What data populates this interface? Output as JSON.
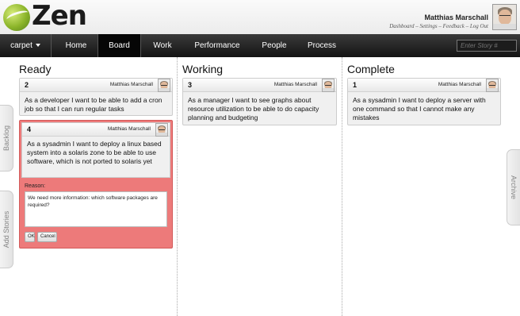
{
  "app": {
    "logo_text": "Zen"
  },
  "user": {
    "name": "Matthias Marschall",
    "links": [
      "Dashboard",
      "Settings",
      "Feedback",
      "Log Out"
    ],
    "link_separator": " – "
  },
  "nav": {
    "project": "carpet",
    "items": [
      "Home",
      "Board",
      "Work",
      "Performance",
      "People",
      "Process"
    ],
    "active": "Board",
    "search_placeholder": "Enter Story #"
  },
  "side_tabs": {
    "backlog": "Backlog",
    "add_stories": "Add Stories",
    "archive": "Archive"
  },
  "columns": [
    {
      "title": "Ready",
      "cards": [
        {
          "number": "2",
          "owner": "Matthias Marschall",
          "text": "As a developer I want to be able to add a cron job so that I can run regular tasks"
        },
        {
          "number": "4",
          "owner": "Matthias Marschall",
          "text": "As a sysadmin I want to deploy a linux based system into a solaris zone to be able to use software, which is not ported to solaris yet",
          "reason_label": "Reason:",
          "reason_text": "We need more information: which software packages are required?",
          "ok_label": "OK",
          "cancel_label": "Cancel"
        }
      ]
    },
    {
      "title": "Working",
      "cards": [
        {
          "number": "3",
          "owner": "Matthias Marschall",
          "text": "As a manager I want to see graphs about resource utilization to be able to do capacity planning and budgeting"
        }
      ]
    },
    {
      "title": "Complete",
      "cards": [
        {
          "number": "1",
          "owner": "Matthias Marschall",
          "text": "As a sysadmin I want to deploy a server with one command so that I cannot make any mistakes"
        }
      ]
    }
  ],
  "colors": {
    "nav_bg": "#1a1a1a",
    "reject_card": "#ed7a7a",
    "logo_green": "#8cb52a"
  }
}
